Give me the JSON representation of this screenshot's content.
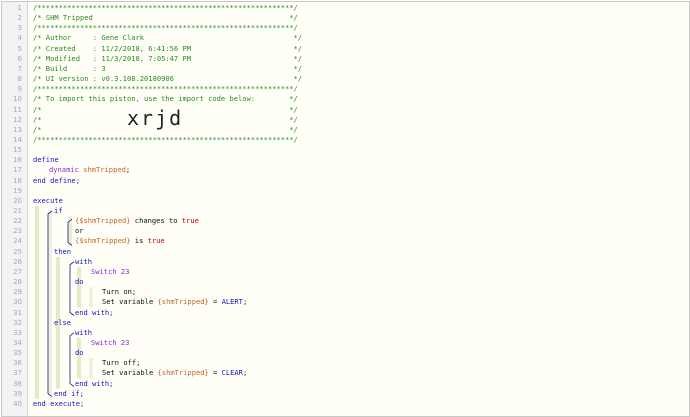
{
  "editor": {
    "lines": [
      {
        "n": "1",
        "indent": 0,
        "segs": [
          {
            "t": "/************************************************************/",
            "c": "comment"
          }
        ]
      },
      {
        "n": "2",
        "indent": 0,
        "segs": [
          {
            "t": "/* SHM Tripped                                              */",
            "c": "comment"
          }
        ]
      },
      {
        "n": "3",
        "indent": 0,
        "segs": [
          {
            "t": "/************************************************************/",
            "c": "comment"
          }
        ]
      },
      {
        "n": "4",
        "indent": 0,
        "segs": [
          {
            "t": "/* Author     : Gene Clark                                   */",
            "c": "comment"
          }
        ]
      },
      {
        "n": "5",
        "indent": 0,
        "segs": [
          {
            "t": "/* Created    : 11/2/2018, 6:41:56 PM                        */",
            "c": "comment"
          }
        ]
      },
      {
        "n": "6",
        "indent": 0,
        "segs": [
          {
            "t": "/* Modified   : 11/3/2018, 7:05:47 PM                        */",
            "c": "comment"
          }
        ]
      },
      {
        "n": "7",
        "indent": 0,
        "segs": [
          {
            "t": "/* Build      : 3                                            */",
            "c": "comment"
          }
        ]
      },
      {
        "n": "8",
        "indent": 0,
        "segs": [
          {
            "t": "/* UI version : v0.3.108.20180906                            */",
            "c": "comment"
          }
        ]
      },
      {
        "n": "9",
        "indent": 0,
        "segs": [
          {
            "t": "/************************************************************/",
            "c": "comment"
          }
        ]
      },
      {
        "n": "10",
        "indent": 0,
        "segs": [
          {
            "t": "/* To import this piston, use the import code below:        */",
            "c": "comment"
          }
        ]
      },
      {
        "n": "11",
        "indent": 0,
        "segs": [
          {
            "t": "/*                                                          */",
            "c": "comment"
          }
        ]
      },
      {
        "n": "12",
        "indent": 0,
        "segs": [
          {
            "t": "/*                                                          */",
            "c": "comment"
          }
        ]
      },
      {
        "n": "13",
        "indent": 0,
        "segs": [
          {
            "t": "/*                                                          */",
            "c": "comment"
          }
        ]
      },
      {
        "n": "14",
        "indent": 0,
        "segs": [
          {
            "t": "/************************************************************/",
            "c": "comment"
          }
        ]
      },
      {
        "n": "15",
        "indent": 0,
        "segs": []
      },
      {
        "n": "16",
        "indent": 0,
        "segs": [
          {
            "t": "define",
            "c": "kw-blue"
          }
        ]
      },
      {
        "n": "17",
        "indent": 16,
        "segs": [
          {
            "t": "dynamic ",
            "c": "kw-purple"
          },
          {
            "t": "shmTripped",
            "c": "var"
          },
          {
            "t": ";",
            "c": "plain"
          }
        ]
      },
      {
        "n": "18",
        "indent": 0,
        "segs": [
          {
            "t": "end define;",
            "c": "kw-blue"
          }
        ]
      },
      {
        "n": "19",
        "indent": 0,
        "segs": []
      },
      {
        "n": "20",
        "indent": 0,
        "segs": [
          {
            "t": "execute",
            "c": "kw-blue"
          }
        ]
      },
      {
        "n": "21",
        "indent": 21,
        "segs": [
          {
            "t": "if",
            "c": "kw-blue"
          }
        ]
      },
      {
        "n": "22",
        "indent": 42,
        "segs": [
          {
            "t": "{$shmTripped}",
            "c": "var"
          },
          {
            "t": " changes to ",
            "c": "plain"
          },
          {
            "t": "true",
            "c": "kw-red"
          }
        ]
      },
      {
        "n": "23",
        "indent": 42,
        "segs": [
          {
            "t": "or",
            "c": "plain"
          }
        ]
      },
      {
        "n": "24",
        "indent": 42,
        "segs": [
          {
            "t": "{$shmTripped}",
            "c": "var"
          },
          {
            "t": " is ",
            "c": "plain"
          },
          {
            "t": "true",
            "c": "kw-red"
          }
        ]
      },
      {
        "n": "25",
        "indent": 21,
        "segs": [
          {
            "t": "then",
            "c": "kw-blue"
          }
        ]
      },
      {
        "n": "26",
        "indent": 42,
        "segs": [
          {
            "t": "with",
            "c": "kw-blue"
          }
        ]
      },
      {
        "n": "27",
        "indent": 58,
        "segs": [
          {
            "t": "Switch 23",
            "c": "kw-purple"
          }
        ]
      },
      {
        "n": "28",
        "indent": 42,
        "segs": [
          {
            "t": "do",
            "c": "kw-blue"
          }
        ]
      },
      {
        "n": "29",
        "indent": 69,
        "segs": [
          {
            "t": "Turn on;",
            "c": "plain"
          }
        ]
      },
      {
        "n": "30",
        "indent": 69,
        "segs": [
          {
            "t": "Set variable ",
            "c": "plain"
          },
          {
            "t": "{shmTripped}",
            "c": "var"
          },
          {
            "t": " = ",
            "c": "plain"
          },
          {
            "t": "ALERT",
            "c": "const"
          },
          {
            "t": ";",
            "c": "plain"
          }
        ]
      },
      {
        "n": "31",
        "indent": 42,
        "segs": [
          {
            "t": "end with;",
            "c": "kw-blue"
          }
        ]
      },
      {
        "n": "32",
        "indent": 21,
        "segs": [
          {
            "t": "else",
            "c": "kw-blue"
          }
        ]
      },
      {
        "n": "33",
        "indent": 42,
        "segs": [
          {
            "t": "with",
            "c": "kw-blue"
          }
        ]
      },
      {
        "n": "34",
        "indent": 58,
        "segs": [
          {
            "t": "Switch 23",
            "c": "kw-purple"
          }
        ]
      },
      {
        "n": "35",
        "indent": 42,
        "segs": [
          {
            "t": "do",
            "c": "kw-blue"
          }
        ]
      },
      {
        "n": "36",
        "indent": 69,
        "segs": [
          {
            "t": "Turn off;",
            "c": "plain"
          }
        ]
      },
      {
        "n": "37",
        "indent": 69,
        "segs": [
          {
            "t": "Set variable ",
            "c": "plain"
          },
          {
            "t": "{shmTripped}",
            "c": "var"
          },
          {
            "t": " = ",
            "c": "plain"
          },
          {
            "t": "CLEAR",
            "c": "const"
          },
          {
            "t": ";",
            "c": "plain"
          }
        ]
      },
      {
        "n": "38",
        "indent": 42,
        "segs": [
          {
            "t": "end with;",
            "c": "kw-blue"
          }
        ]
      },
      {
        "n": "39",
        "indent": 21,
        "segs": [
          {
            "t": "end if;",
            "c": "kw-blue"
          }
        ]
      },
      {
        "n": "40",
        "indent": 0,
        "segs": [
          {
            "t": "end execute;",
            "c": "kw-blue"
          }
        ]
      }
    ],
    "import_code": "xrjd"
  },
  "colors": {
    "comment": "#2a8a22",
    "keyword": "#1414c8",
    "variable": "#c8642a",
    "device": "#8a2bd2",
    "boolean": "#c80000",
    "guide": "#b8d0e8",
    "bracket": "#1414c8"
  }
}
